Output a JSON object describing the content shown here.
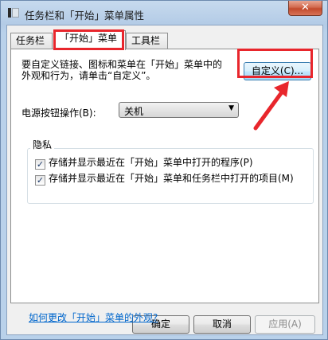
{
  "window": {
    "title": "任务栏和「开始」菜单属性",
    "close_label": "✕"
  },
  "tabs": [
    {
      "label": "任务栏",
      "active": false
    },
    {
      "label": "「开始」菜单",
      "active": true
    },
    {
      "label": "工具栏",
      "active": false
    }
  ],
  "panel": {
    "description_line1": "要自定义链接、图标和菜单在「开始」菜单中的",
    "description_line2": "外观和行为，请单击“自定义”。",
    "customize_label": "自定义(C)...",
    "power_label": "电源按钮操作(B):",
    "power_value": "关机",
    "privacy_group_label": "隐私",
    "privacy_options": [
      {
        "label": "存储并显示最近在「开始」菜单中打开的程序(P)",
        "checked": true
      },
      {
        "label": "存储并显示最近在「开始」菜单和任务栏中打开的项目(M)",
        "checked": true
      }
    ],
    "help_link": "如何更改「开始」菜单的外观?"
  },
  "buttons": {
    "ok": "确定",
    "cancel": "取消",
    "apply": "应用(A)"
  },
  "colors": {
    "annotation": "#e8262c",
    "link": "#0066cc"
  }
}
